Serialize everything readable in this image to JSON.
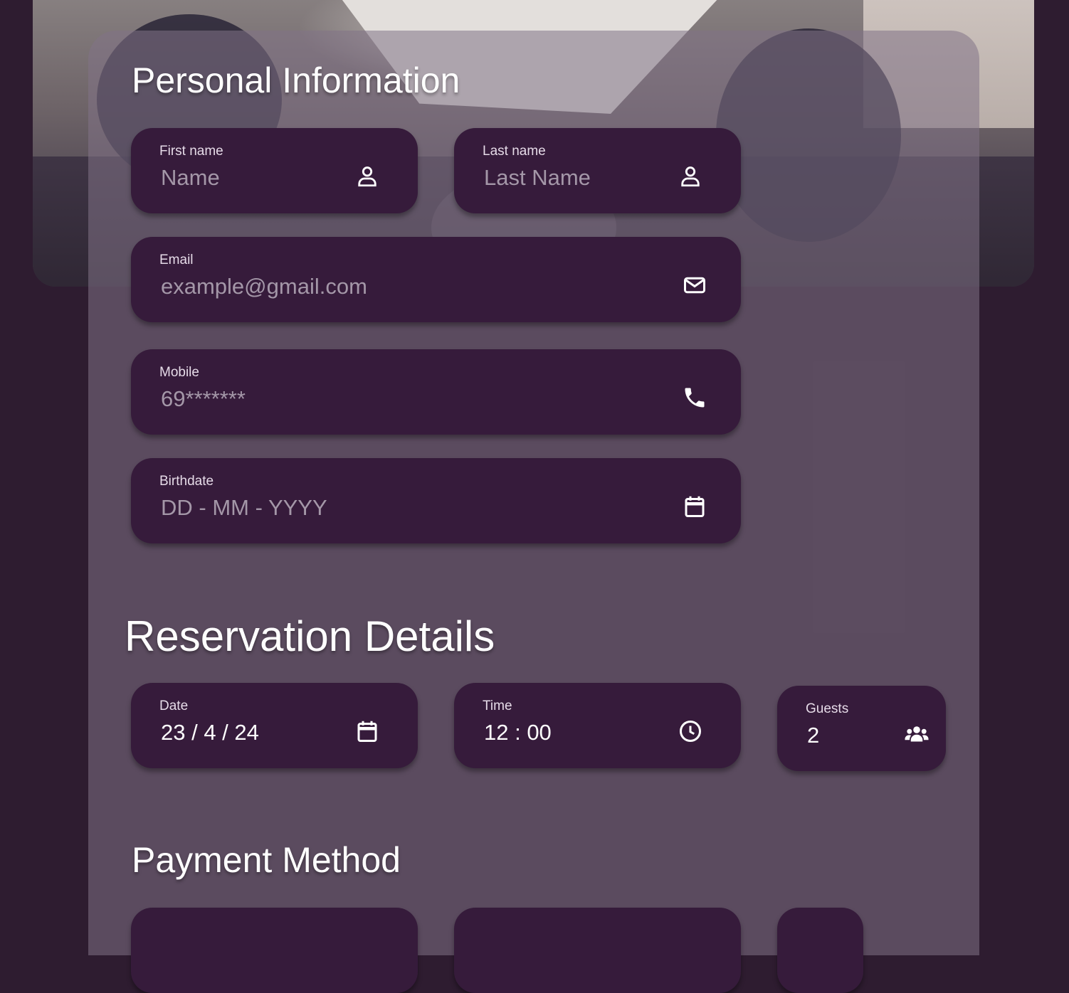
{
  "personal": {
    "title": "Personal Information",
    "first_name": {
      "label": "First name",
      "placeholder": "Name",
      "icon": "person-icon"
    },
    "last_name": {
      "label": "Last name",
      "placeholder": "Last Name",
      "icon": "person-icon"
    },
    "email": {
      "label": "Email",
      "placeholder": "example@gmail.com",
      "icon": "envelope-icon"
    },
    "mobile": {
      "label": "Mobile",
      "placeholder": "69*******",
      "icon": "phone-icon"
    },
    "birthdate": {
      "label": "Birthdate",
      "placeholder": "DD - MM - YYYY",
      "icon": "calendar-icon"
    }
  },
  "reservation": {
    "title": "Reservation Details",
    "date": {
      "label": "Date",
      "value": "23 / 4 / 24",
      "icon": "calendar-icon"
    },
    "time": {
      "label": "Time",
      "value": "12 : 00",
      "icon": "clock-icon"
    },
    "guests": {
      "label": "Guests",
      "value": "2",
      "icon": "group-icon"
    }
  },
  "payment": {
    "title": "Payment Method"
  },
  "colors": {
    "page_bg": "#2e1c30",
    "field_bg": "#361b3b",
    "card_overlay": "#827387",
    "placeholder_text": "#a497a8",
    "label_text": "#e6dbe8"
  }
}
